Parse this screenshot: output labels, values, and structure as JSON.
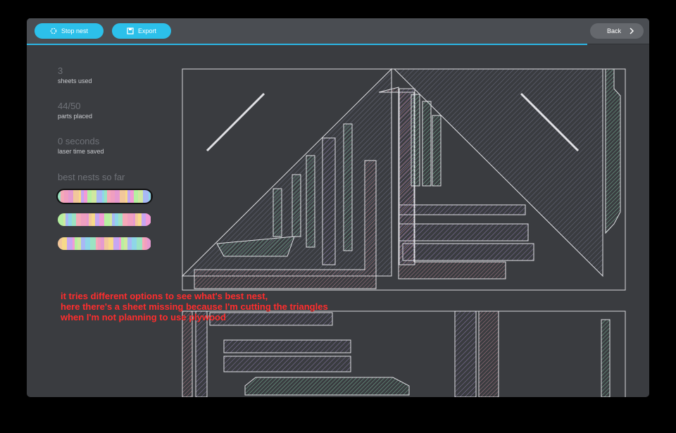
{
  "toolbar": {
    "stop_label": "Stop nest",
    "export_label": "Export",
    "back_label": "Back",
    "progress_percent": 90
  },
  "stats": {
    "sheets_value": "3",
    "sheets_label": "sheets used",
    "parts_value": "44/50",
    "parts_label": "parts placed",
    "time_value": "0 seconds",
    "time_label": "laser time saved",
    "best_title": "best nests so far"
  },
  "annotation": {
    "line1": "it tries different options to see what's best nest,",
    "line2": "here there's a sheet missing because I'm cutting the triangles",
    "line3": "when I'm not planning to use plywood"
  },
  "colors": {
    "accent": "#2cc0ea",
    "background": "#3a3c40",
    "annotation": "#ff2d2d"
  }
}
